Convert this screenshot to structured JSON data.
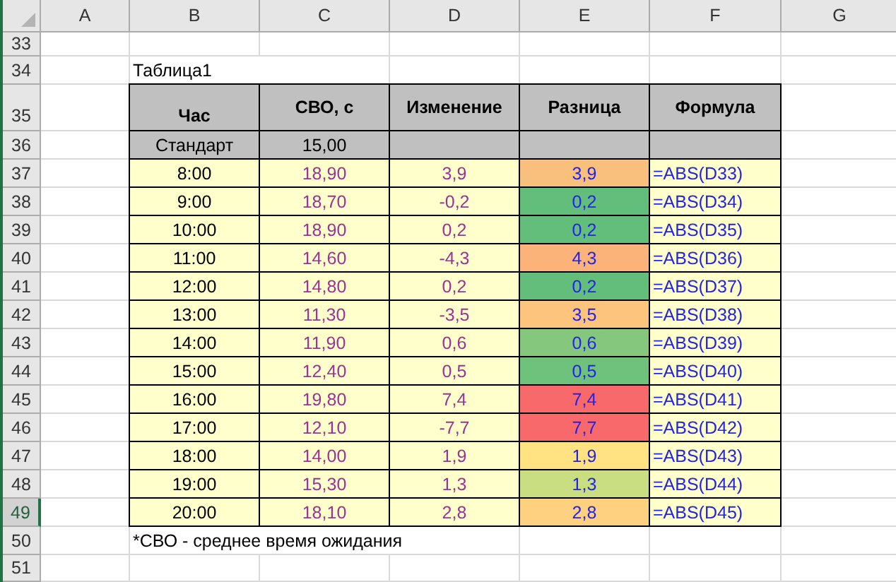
{
  "column_headers": [
    {
      "label": "A",
      "selected": false
    },
    {
      "label": "B",
      "selected": false
    },
    {
      "label": "C",
      "selected": false
    },
    {
      "label": "D",
      "selected": false
    },
    {
      "label": "E",
      "selected": false
    },
    {
      "label": "F",
      "selected": false
    },
    {
      "label": "G",
      "selected": false
    }
  ],
  "row_headers": [
    {
      "label": "33",
      "selected": false
    },
    {
      "label": "34",
      "selected": false
    },
    {
      "label": "35",
      "selected": false
    },
    {
      "label": "36",
      "selected": false
    },
    {
      "label": "37",
      "selected": false
    },
    {
      "label": "38",
      "selected": false
    },
    {
      "label": "39",
      "selected": false
    },
    {
      "label": "40",
      "selected": false
    },
    {
      "label": "41",
      "selected": false
    },
    {
      "label": "42",
      "selected": false
    },
    {
      "label": "43",
      "selected": false
    },
    {
      "label": "44",
      "selected": false
    },
    {
      "label": "45",
      "selected": false
    },
    {
      "label": "46",
      "selected": false
    },
    {
      "label": "47",
      "selected": false
    },
    {
      "label": "48",
      "selected": false
    },
    {
      "label": "49",
      "selected": true
    },
    {
      "label": "50",
      "selected": false
    },
    {
      "label": "51",
      "selected": false
    }
  ],
  "table_title": "Таблица1",
  "table": {
    "columns": [
      "Час",
      "СВО, с",
      "Изменение",
      "Разница",
      "Формула"
    ],
    "standard_row": [
      "Стандарт",
      "15,00"
    ],
    "rows": [
      {
        "hour": "8:00",
        "wait": "18,90",
        "change": "3,9",
        "difference": "3,9",
        "color": "#f9bf7d",
        "formula": "=ABS(D33)"
      },
      {
        "hour": "9:00",
        "wait": "18,70",
        "change": "-0,2",
        "difference": "0,2",
        "color": "#63be7b",
        "formula": "=ABS(D34)"
      },
      {
        "hour": "10:00",
        "wait": "18,90",
        "change": "0,2",
        "difference": "0,2",
        "color": "#63be7b",
        "formula": "=ABS(D35)"
      },
      {
        "hour": "11:00",
        "wait": "14,60",
        "change": "-4,3",
        "difference": "4,3",
        "color": "#fbb379",
        "formula": "=ABS(D36)"
      },
      {
        "hour": "12:00",
        "wait": "14,80",
        "change": "0,2",
        "difference": "0,2",
        "color": "#63be7b",
        "formula": "=ABS(D37)"
      },
      {
        "hour": "13:00",
        "wait": "11,30",
        "change": "-3,5",
        "difference": "3,5",
        "color": "#fcc47d",
        "formula": "=ABS(D38)"
      },
      {
        "hour": "14:00",
        "wait": "11,90",
        "change": "0,6",
        "difference": "0,6",
        "color": "#85c77c",
        "formula": "=ABS(D39)"
      },
      {
        "hour": "15:00",
        "wait": "12,40",
        "change": "0,5",
        "difference": "0,5",
        "color": "#6fc27b",
        "formula": "=ABS(D40)"
      },
      {
        "hour": "16:00",
        "wait": "19,80",
        "change": "7,4",
        "difference": "7,4",
        "color": "#f8696b",
        "formula": "=ABS(D41)"
      },
      {
        "hour": "17:00",
        "wait": "12,10",
        "change": "-7,7",
        "difference": "7,7",
        "color": "#f8696b",
        "formula": "=ABS(D42)"
      },
      {
        "hour": "18:00",
        "wait": "14,00",
        "change": "1,9",
        "difference": "1,9",
        "color": "#ffe383",
        "formula": "=ABS(D43)"
      },
      {
        "hour": "19:00",
        "wait": "15,30",
        "change": "1,3",
        "difference": "1,3",
        "color": "#c9dd81",
        "formula": "=ABS(D44)"
      },
      {
        "hour": "20:00",
        "wait": "18,10",
        "change": "2,8",
        "difference": "2,8",
        "color": "#fdd17f",
        "formula": "=ABS(D45)"
      }
    ]
  },
  "footnote": "*СВО - среднее время ожидания"
}
